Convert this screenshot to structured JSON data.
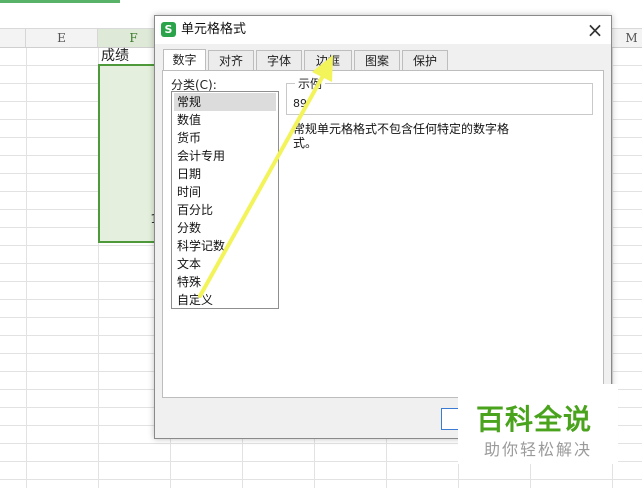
{
  "spreadsheet": {
    "columns": [
      {
        "label": "E"
      },
      {
        "label": "F"
      },
      {
        "label": "M"
      }
    ],
    "f_header": "成绩",
    "f_visible_digits": [
      "1"
    ]
  },
  "dialog": {
    "title": "单元格格式",
    "icon_letter": "S",
    "close_glyph": "×",
    "tabs": [
      "数字",
      "对齐",
      "字体",
      "边框",
      "图案",
      "保护"
    ],
    "active_tab": "数字",
    "category_label": "分类(C):",
    "categories": [
      "常规",
      "数值",
      "货币",
      "会计专用",
      "日期",
      "时间",
      "百分比",
      "分数",
      "科学记数",
      "文本",
      "特殊",
      "自定义"
    ],
    "selected_category": "常规",
    "sample_label": "示例",
    "sample_value": "89",
    "description": "常规单元格格式不包含任何特定的数字格式。"
  },
  "annotation": {
    "arrow_color": "#f3f35a"
  },
  "colors": {
    "accent_green": "#4e9a3a",
    "selection_fill": "#e4f0dd",
    "ok_button_border": "#3b7bd4"
  },
  "watermark": {
    "main": "百科全说",
    "sub": "助你轻松解决"
  }
}
